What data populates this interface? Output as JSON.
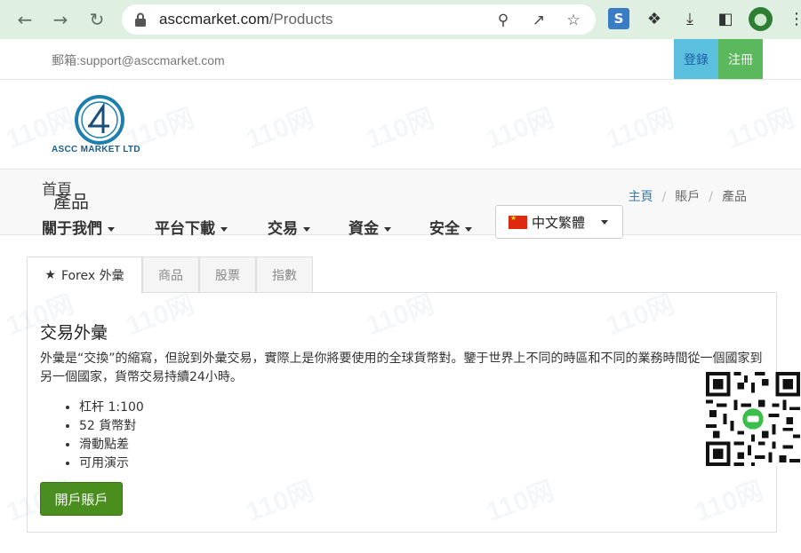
{
  "browser": {
    "url_domain": "asccmarket.com",
    "url_path": "/Products"
  },
  "topbar": {
    "email": "郵箱:support@asccmarket.com",
    "login": "登錄",
    "register": "注冊"
  },
  "logo": {
    "text": "ASCC MARKET LTD"
  },
  "nav": {
    "home": "首頁",
    "page_title": "產品",
    "items": [
      {
        "label": "關于我們"
      },
      {
        "label": "平台下載"
      },
      {
        "label": "交易"
      },
      {
        "label": "資金"
      },
      {
        "label": "安全"
      }
    ],
    "language": "中文繁體"
  },
  "breadcrumb": {
    "home": "主頁",
    "account": "賬戶",
    "products": "產品"
  },
  "tabs": [
    {
      "label": "Forex 外彙",
      "active": true
    },
    {
      "label": "商品"
    },
    {
      "label": "股票"
    },
    {
      "label": "指數"
    }
  ],
  "content": {
    "title": "交易外彙",
    "description": "外彙是“交換”的縮寫，但說到外彙交易，實際上是你將要使用的全球貨幣對。鑒于世界上不同的時區和不同的業務時間從一個國家到另一個國家，貨幣交易持續24小時。",
    "bullets": [
      "杠杆 1:100",
      "52 貨幣對",
      "滑動點差",
      "可用演示"
    ],
    "button": "開戶賬戶"
  },
  "watermark": "110网",
  "colors": {
    "login_bg": "#5bc0de",
    "register_bg": "#5cb85c",
    "button_bg": "#4a8e1e",
    "chrome_bg": "#dff0e3"
  }
}
